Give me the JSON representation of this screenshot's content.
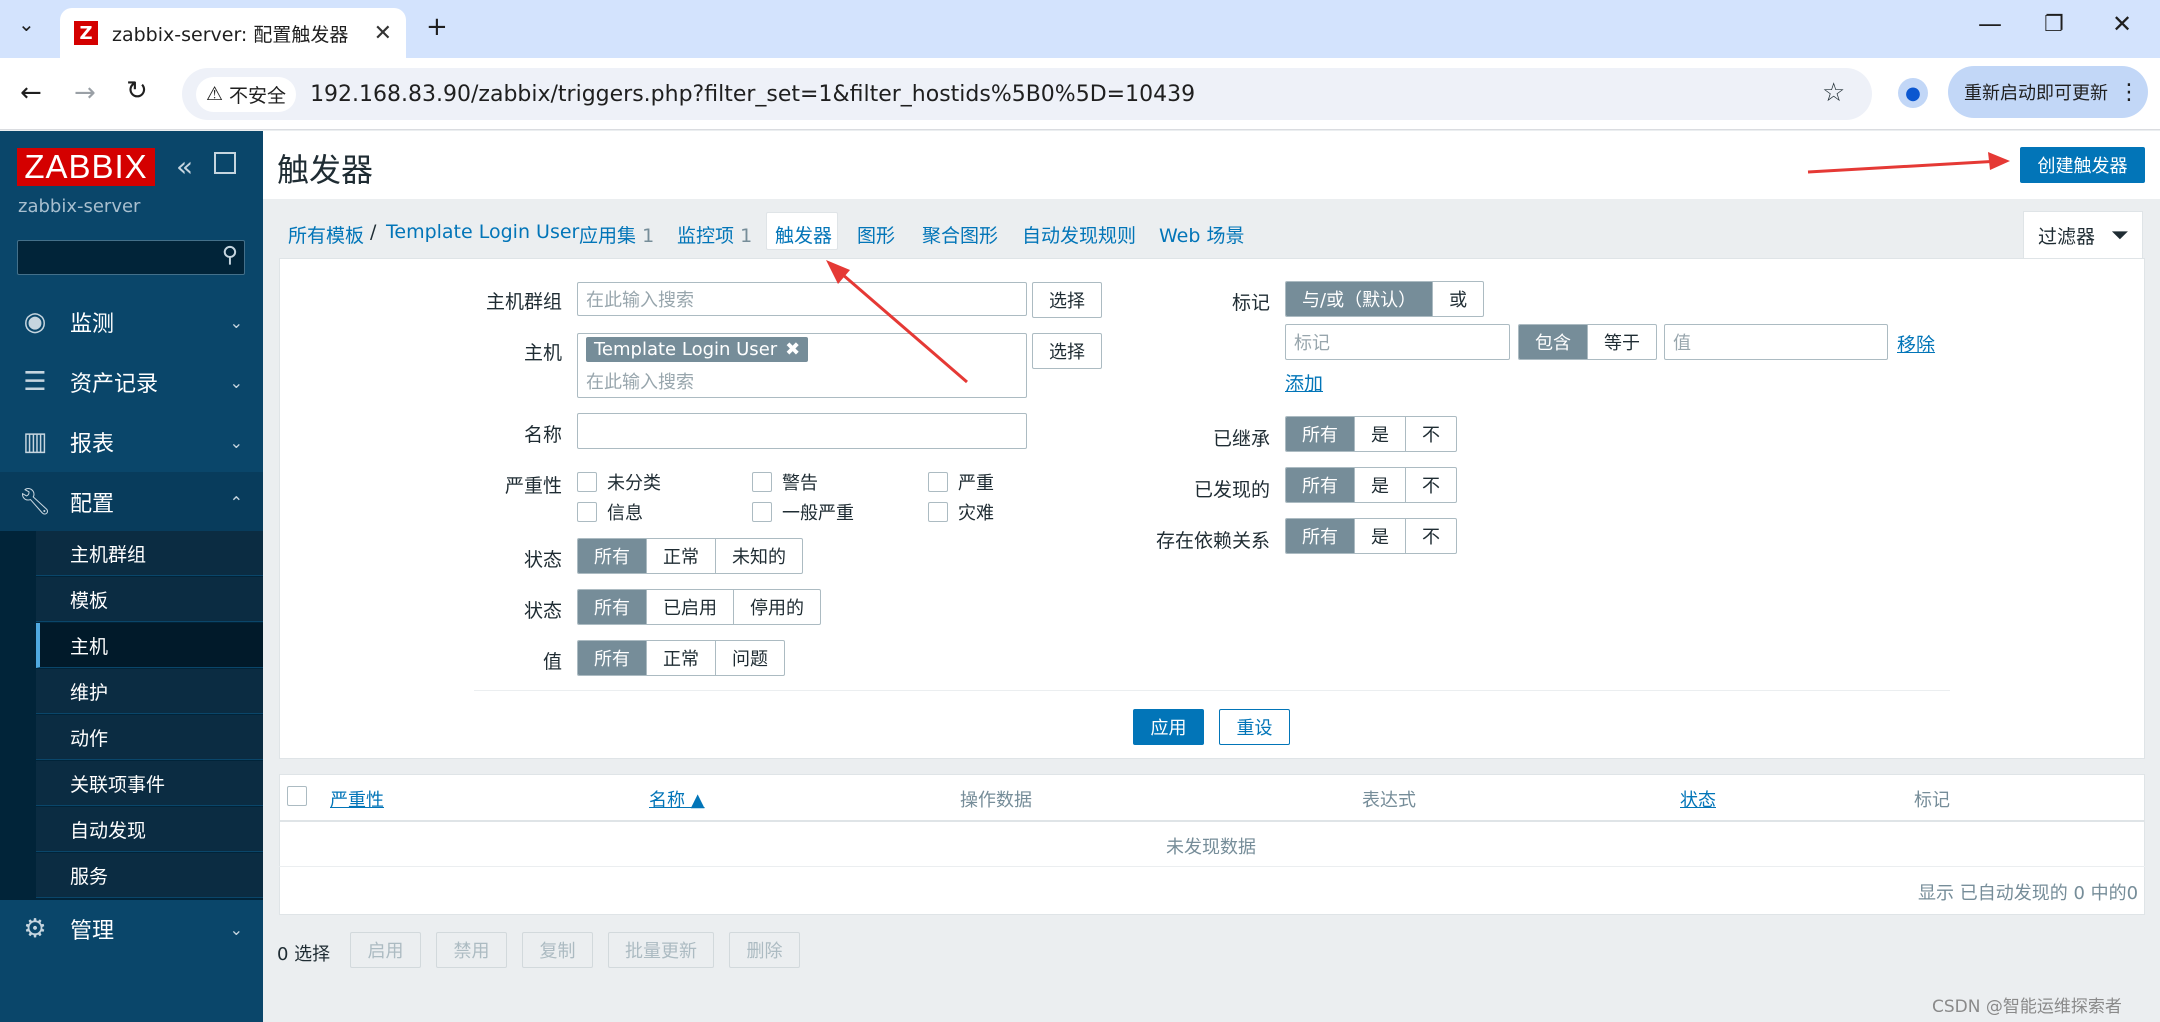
{
  "browser": {
    "tab_title": "zabbix-server: 配置触发器",
    "tab_favicon": "Z",
    "security": "不安全",
    "url": "192.168.83.90/zabbix/triggers.php?filter_set=1&filter_hostids%5B0%5D=10439",
    "update_label": "重新启动即可更新"
  },
  "sidebar": {
    "logo": "ZABBIX",
    "server": "zabbix-server",
    "menu": [
      {
        "label": "监测",
        "icon": "eye-icon"
      },
      {
        "label": "资产记录",
        "icon": "list-icon"
      },
      {
        "label": "报表",
        "icon": "bar-chart-icon"
      },
      {
        "label": "配置",
        "icon": "wrench-icon"
      },
      {
        "label": "管理",
        "icon": "gear-icon"
      }
    ],
    "submenu": [
      "主机群组",
      "模板",
      "主机",
      "维护",
      "动作",
      "关联项事件",
      "自动发现",
      "服务"
    ],
    "selected_sub": "主机"
  },
  "page": {
    "title": "触发器",
    "create_button": "创建触发器"
  },
  "nav": {
    "all_templates": "所有模板",
    "sep": "/",
    "template": "Template Login User",
    "apps": "应用集",
    "apps_count": "1",
    "items": "监控项",
    "items_count": "1",
    "triggers": "触发器",
    "graphs": "图形",
    "screens": "聚合图形",
    "discovery": "自动发现规则",
    "web": "Web 场景",
    "filter": "过滤器"
  },
  "filter": {
    "hostgroup_label": "主机群组",
    "hostgroup_placeholder": "在此输入搜索",
    "select_btn": "选择",
    "host_label": "主机",
    "host_tag": "Template Login User",
    "host_placeholder": "在此输入搜索",
    "name_label": "名称",
    "severity_label": "严重性",
    "severities": [
      "未分类",
      "警告",
      "严重",
      "信息",
      "一般严重",
      "灾难"
    ],
    "state_label": "状态",
    "state_opts": [
      "所有",
      "正常",
      "未知的"
    ],
    "status_label": "状态",
    "status_opts": [
      "所有",
      "已启用",
      "停用的"
    ],
    "value_label": "值",
    "value_opts": [
      "所有",
      "正常",
      "问题"
    ],
    "tags_label": "标记",
    "tags_opts": [
      "与/或（默认）",
      "或"
    ],
    "tag_placeholder": "标记",
    "tag_ops": [
      "包含",
      "等于"
    ],
    "tag_value_placeholder": "值",
    "remove": "移除",
    "add": "添加",
    "inherited_label": "已继承",
    "discovered_label": "已发现的",
    "depends_label": "存在依赖关系",
    "yn_opts": [
      "所有",
      "是",
      "不"
    ],
    "apply": "应用",
    "reset": "重设"
  },
  "table": {
    "cols": [
      "严重性",
      "名称 ▲",
      "操作数据",
      "表达式",
      "状态",
      "标记"
    ],
    "empty": "未发现数据",
    "footer": "显示 已自动发现的 0 中的0"
  },
  "actions": {
    "selected": "0 选择",
    "buttons": [
      "启用",
      "禁用",
      "复制",
      "批量更新",
      "删除"
    ]
  },
  "watermark": "CSDN @智能运维探索者"
}
